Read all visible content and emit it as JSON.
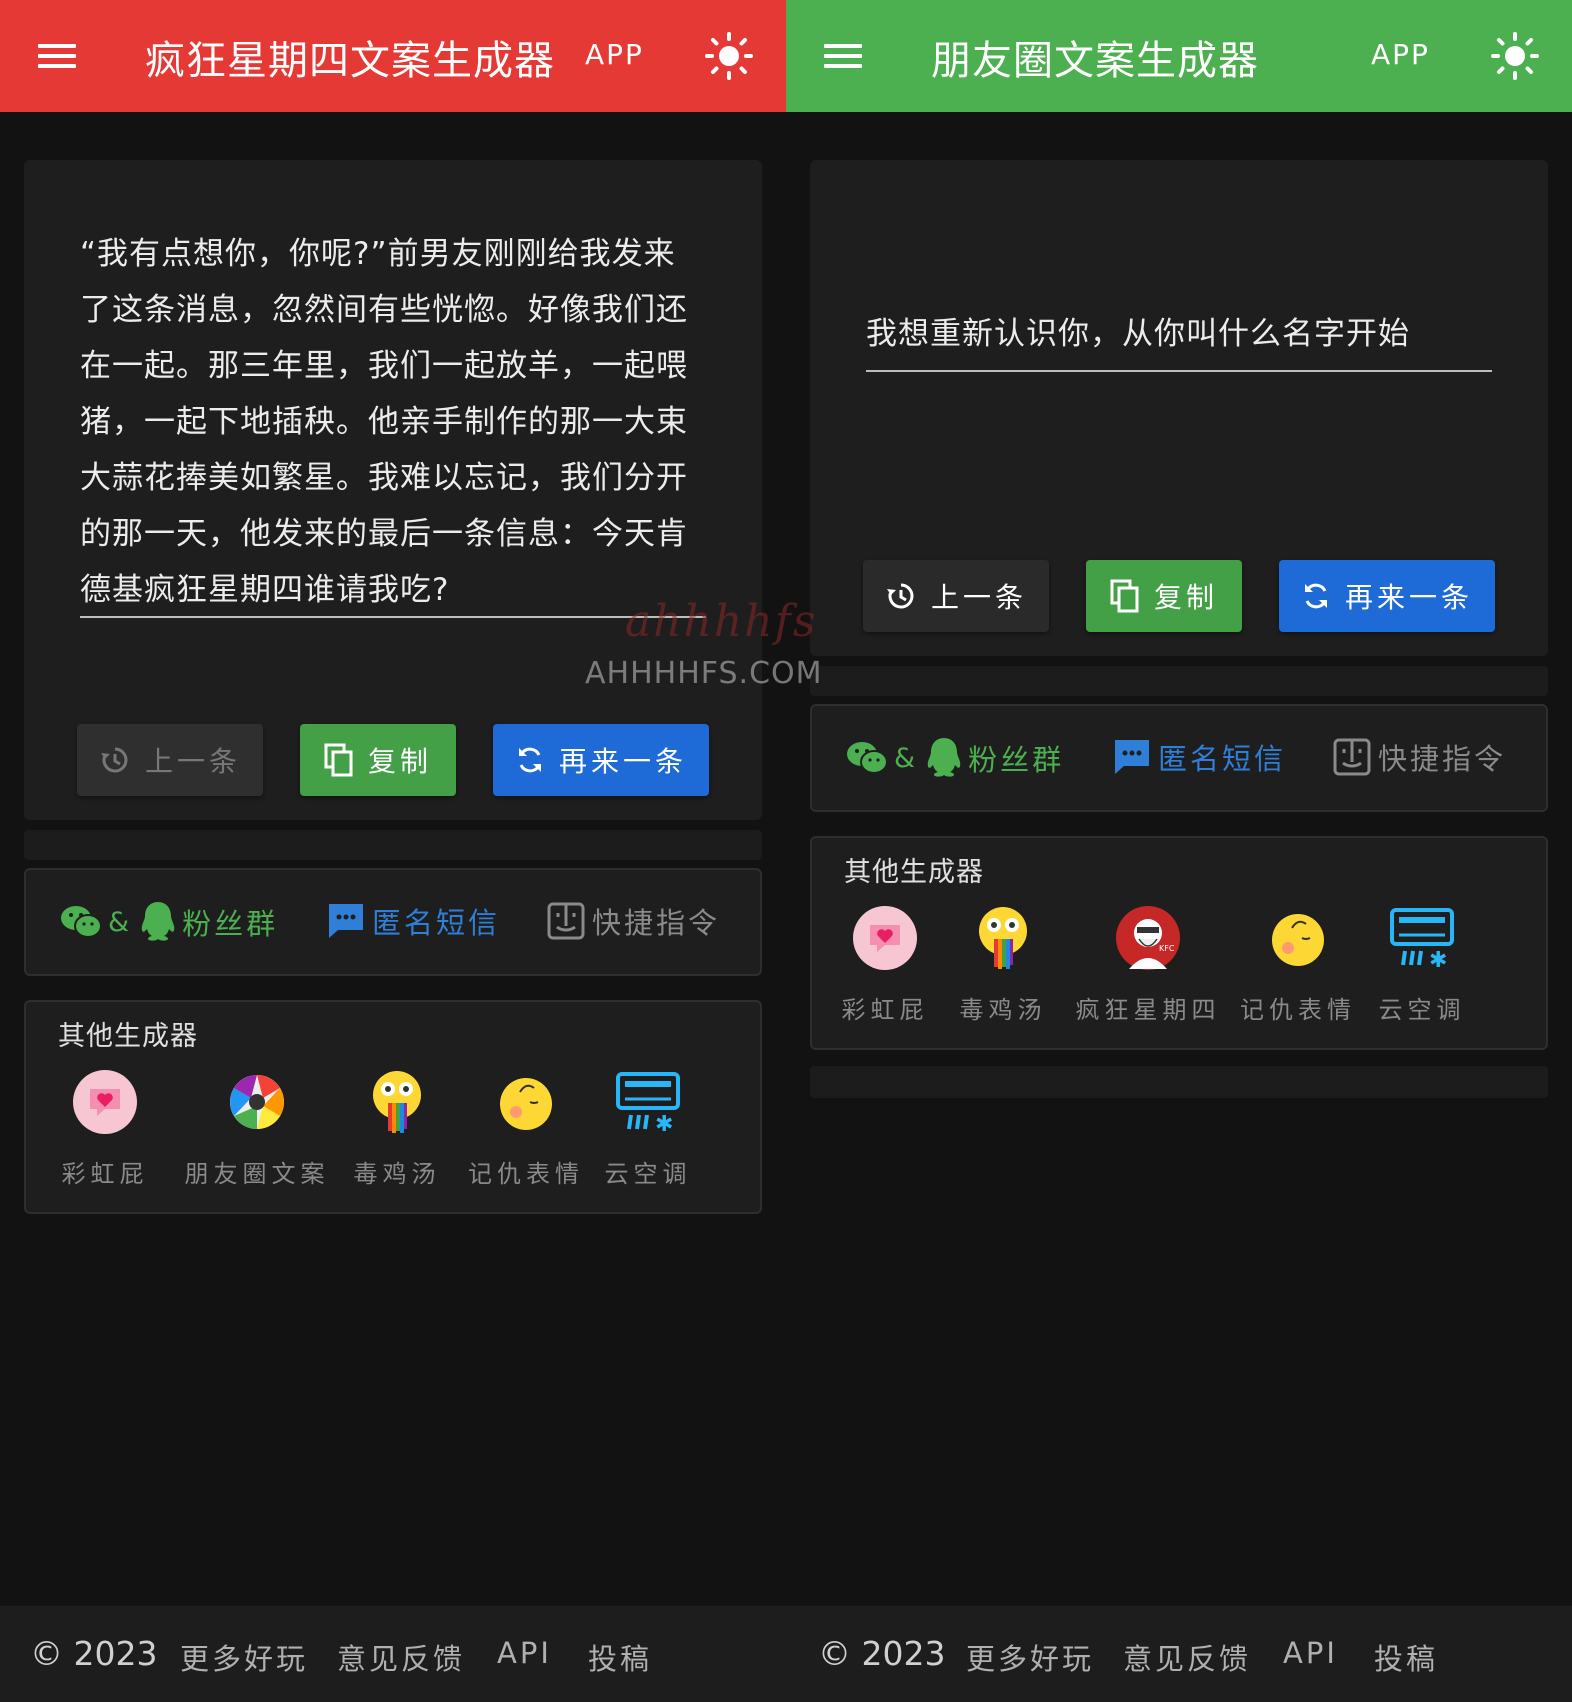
{
  "left_panel": {
    "header_color": "#e53935",
    "title": "疯狂星期四文案生成器",
    "app_link": "APP",
    "quote": "“我有点想你，你呢?”前男友刚刚给我发来了这条消息，忽然间有些恍惚。好像我们还在一起。那三年里，我们一起放羊，一起喂猪，一起下地插秧。他亲手制作的那一大束大蒜花捧美如繁星。我难以忘记，我们分开的那一天，他发来的最后一条信息：今天肯德基疯狂星期四谁请我吃?",
    "buttons": {
      "prev": "上一条",
      "copy": "复制",
      "next": "再来一条"
    },
    "links": {
      "fans": "粉丝群",
      "amp": "&",
      "sms": "匿名短信",
      "shortcut": "快捷指令"
    },
    "generators_title": "其他生成器",
    "generators": [
      {
        "label": "彩虹屁",
        "icon": "heart-bubble-icon"
      },
      {
        "label": "朋友圈文案",
        "icon": "aperture-icon"
      },
      {
        "label": "毒鸡汤",
        "icon": "rainbow-puke-face-icon"
      },
      {
        "label": "记仇表情",
        "icon": "grumpy-face-icon"
      },
      {
        "label": "云空调",
        "icon": "air-conditioner-icon"
      }
    ],
    "footer": {
      "copyright": "© 2023",
      "more": "更多好玩",
      "feedback": "意见反馈",
      "api": "API",
      "submit": "投稿"
    }
  },
  "right_panel": {
    "header_color": "#4caf50",
    "title": "朋友圈文案生成器",
    "app_link": "APP",
    "quote": "我想重新认识你，从你叫什么名字开始",
    "buttons": {
      "prev": "上一条",
      "copy": "复制",
      "next": "再来一条"
    },
    "links": {
      "fans": "粉丝群",
      "amp": "&",
      "sms": "匿名短信",
      "shortcut": "快捷指令"
    },
    "generators_title": "其他生成器",
    "generators": [
      {
        "label": "彩虹屁",
        "icon": "heart-bubble-icon"
      },
      {
        "label": "毒鸡汤",
        "icon": "rainbow-puke-face-icon"
      },
      {
        "label": "疯狂星期四",
        "icon": "kfc-logo-icon"
      },
      {
        "label": "记仇表情",
        "icon": "grumpy-face-icon"
      },
      {
        "label": "云空调",
        "icon": "air-conditioner-icon"
      }
    ],
    "footer": {
      "copyright": "© 2023",
      "more": "更多好玩",
      "feedback": "意见反馈",
      "api": "API",
      "submit": "投稿"
    }
  },
  "watermark": {
    "script": "ahhhhfs",
    "domain": "AHHHHFS.COM"
  }
}
